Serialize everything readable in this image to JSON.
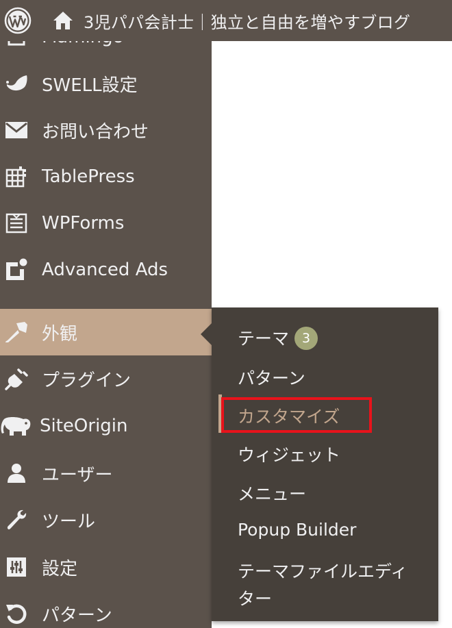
{
  "adminbar": {
    "site_title": "3児パパ会計士｜独立と自由を増やすブログ"
  },
  "sidebar": {
    "items": [
      {
        "label": "Flamingo",
        "icon": "flamingo-icon"
      },
      {
        "label": "SWELL設定",
        "icon": "swell-icon"
      },
      {
        "label": "お問い合わせ",
        "icon": "mail-icon"
      },
      {
        "label": "TablePress",
        "icon": "tablepress-icon"
      },
      {
        "label": "WPForms",
        "icon": "wpforms-icon"
      },
      {
        "label": "Advanced Ads",
        "icon": "advanced-ads-icon"
      },
      {
        "label": "外観",
        "icon": "paintbrush-icon",
        "current": true
      },
      {
        "label": "プラグイン",
        "icon": "plugin-icon"
      },
      {
        "label": "SiteOrigin",
        "icon": "elephant-icon"
      },
      {
        "label": "ユーザー",
        "icon": "user-icon"
      },
      {
        "label": "ツール",
        "icon": "wrench-icon"
      },
      {
        "label": "設定",
        "icon": "settings-sliders-icon"
      },
      {
        "label": "パターン",
        "icon": "undo-icon"
      }
    ]
  },
  "submenu": {
    "items": [
      {
        "label": "テーマ",
        "badge": "3"
      },
      {
        "label": "パターン"
      },
      {
        "label": "カスタマイズ",
        "active": true
      },
      {
        "label": "ウィジェット"
      },
      {
        "label": "メニュー"
      },
      {
        "label": "Popup Builder"
      },
      {
        "label": "テーマファイルエディ",
        "label_line2": "ター"
      }
    ]
  },
  "colors": {
    "sidebar_bg": "#5b524b",
    "submenu_bg": "#46403a",
    "current_item_bg": "#c2a68d",
    "badge_bg": "#a3a778",
    "highlight_box": "#e8131b"
  }
}
